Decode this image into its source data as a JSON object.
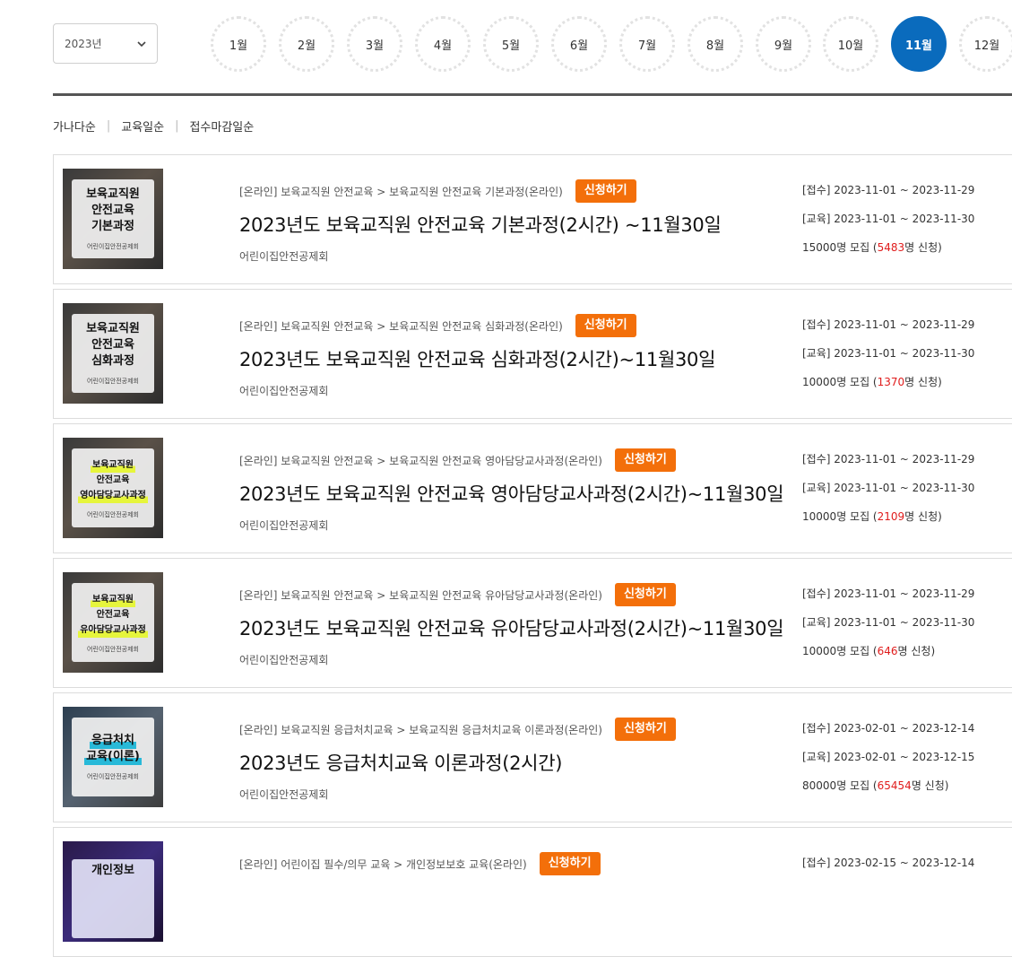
{
  "year_select": {
    "value": "2023년"
  },
  "months": [
    {
      "label": "1월",
      "active": false
    },
    {
      "label": "2월",
      "active": false
    },
    {
      "label": "3월",
      "active": false
    },
    {
      "label": "4월",
      "active": false
    },
    {
      "label": "5월",
      "active": false
    },
    {
      "label": "6월",
      "active": false
    },
    {
      "label": "7월",
      "active": false
    },
    {
      "label": "8월",
      "active": false
    },
    {
      "label": "9월",
      "active": false
    },
    {
      "label": "10월",
      "active": false
    },
    {
      "label": "11월",
      "active": true
    },
    {
      "label": "12월",
      "active": false
    }
  ],
  "sort_options": [
    "가나다순",
    "교육일순",
    "접수마감일순"
  ],
  "apply_label": "신청하기",
  "people_suffix": "명 모집 (",
  "applied_suffix": "명 신청)",
  "courses": [
    {
      "thumb_lines": [
        "보육교직원",
        "안전교육",
        "기본과정"
      ],
      "thumb_org": "어린이집안전공제회",
      "breadcrumb": "[온라인] 보육교직원 안전교육 > 보육교직원 안전교육 기본과정(온라인)",
      "title": "2023년도 보육교직원 안전교육 기본과정(2시간) ~11월30일",
      "org": "어린이집안전공제회",
      "receipt": "[접수] 2023-11-01 ~ 2023-11-29",
      "education": "[교육] 2023-11-01 ~ 2023-11-30",
      "capacity": "15000",
      "applied": "5483"
    },
    {
      "thumb_lines": [
        "보육교직원",
        "안전교육",
        "심화과정"
      ],
      "thumb_org": "어린이집안전공제회",
      "breadcrumb": "[온라인] 보육교직원 안전교육 > 보육교직원 안전교육 심화과정(온라인)",
      "title": "2023년도 보육교직원 안전교육 심화과정(2시간)~11월30일",
      "org": "어린이집안전공제회",
      "receipt": "[접수] 2023-11-01 ~ 2023-11-29",
      "education": "[교육] 2023-11-01 ~ 2023-11-30",
      "capacity": "10000",
      "applied": "1370"
    },
    {
      "thumb_lines": [
        "보육교직원",
        "안전교육",
        "영아담당교사과정"
      ],
      "thumb_org": "어린이집안전공제회",
      "breadcrumb": "[온라인] 보육교직원 안전교육 > 보육교직원 안전교육 영아담당교사과정(온라인)",
      "title": "2023년도 보육교직원 안전교육 영아담당교사과정(2시간)~11월30일",
      "org": "어린이집안전공제회",
      "receipt": "[접수] 2023-11-01 ~ 2023-11-29",
      "education": "[교육] 2023-11-01 ~ 2023-11-30",
      "capacity": "10000",
      "applied": "2109"
    },
    {
      "thumb_lines": [
        "보육교직원",
        "안전교육",
        "유아담당교사과정"
      ],
      "thumb_org": "어린이집안전공제회",
      "breadcrumb": "[온라인] 보육교직원 안전교육 > 보육교직원 안전교육 유아담당교사과정(온라인)",
      "title": "2023년도 보육교직원 안전교육 유아담당교사과정(2시간)~11월30일",
      "org": "어린이집안전공제회",
      "receipt": "[접수] 2023-11-01 ~ 2023-11-29",
      "education": "[교육] 2023-11-01 ~ 2023-11-30",
      "capacity": "10000",
      "applied": "646"
    },
    {
      "thumb_lines": [
        "응급처치",
        "교육(이론)"
      ],
      "thumb_org": "어린이집안전공제회",
      "breadcrumb": "[온라인] 보육교직원 응급처치교육 > 보육교직원 응급처치교육 이론과정(온라인)",
      "title": "2023년도 응급처치교육 이론과정(2시간)",
      "org": "어린이집안전공제회",
      "receipt": "[접수] 2023-02-01 ~ 2023-12-14",
      "education": "[교육] 2023-02-01 ~ 2023-12-15",
      "capacity": "80000",
      "applied": "65454"
    },
    {
      "thumb_lines": [
        "개인정보"
      ],
      "thumb_org": "",
      "breadcrumb": "[온라인] 어린이집 필수/의무 교육 > 개인정보보호 교육(온라인)",
      "title": "",
      "org": "",
      "receipt": "[접수] 2023-02-15 ~ 2023-12-14",
      "education": "",
      "capacity": "",
      "applied": ""
    }
  ],
  "colors": {
    "accent_blue": "#0a6bbd",
    "apply_orange": "#f36f0a",
    "applied_red": "#e01c1c"
  }
}
